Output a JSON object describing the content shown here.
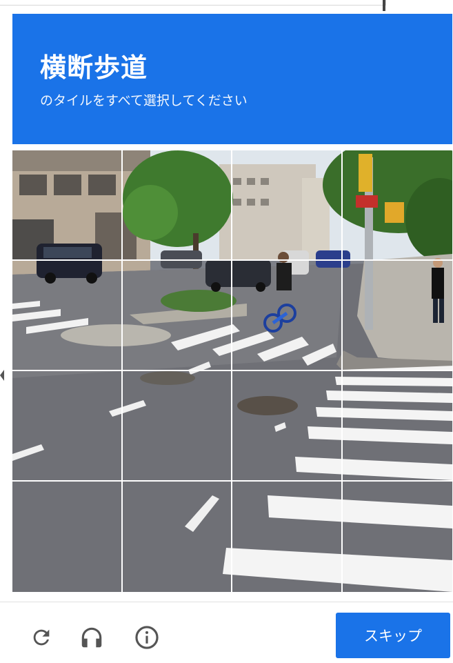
{
  "challenge": {
    "title": "横断歩道",
    "subtitle": "のタイルをすべて選択してください"
  },
  "grid": {
    "rows": 4,
    "columns": 4,
    "tiles": [
      "tile-1-1",
      "tile-1-2",
      "tile-1-3",
      "tile-1-4",
      "tile-2-1",
      "tile-2-2",
      "tile-2-3",
      "tile-2-4",
      "tile-3-1",
      "tile-3-2",
      "tile-3-3",
      "tile-3-4",
      "tile-4-1",
      "tile-4-2",
      "tile-4-3",
      "tile-4-4"
    ]
  },
  "footer": {
    "icons": [
      "reload-icon",
      "headphones-icon",
      "info-icon"
    ],
    "skip_label": "スキップ"
  },
  "colors": {
    "accent": "#1a73e8",
    "icon": "#555555",
    "grid_line": "#ffffff"
  }
}
